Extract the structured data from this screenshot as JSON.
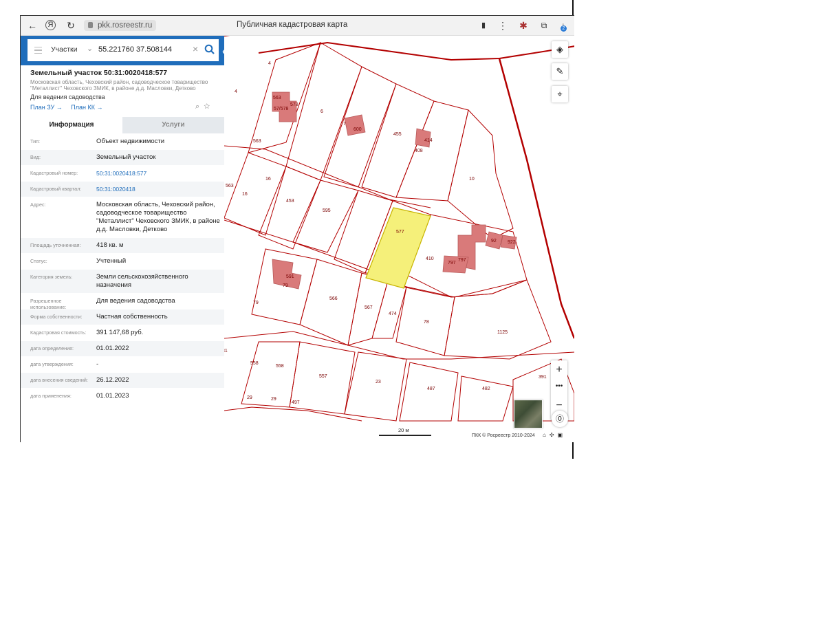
{
  "browser": {
    "url": "pkk.rosreestr.ru",
    "title": "Публичная кадастровая карта",
    "download_count": "2",
    "icons": [
      "back-arrow-icon",
      "yandex-icon",
      "reload-icon",
      "lock-icon",
      "bookmark-icon",
      "menu-dots-icon",
      "extension-icon",
      "translate-icon",
      "download-icon"
    ]
  },
  "search": {
    "type_label": "Участки",
    "value": "55.221760 37.508144"
  },
  "object": {
    "title": "Земельный участок 50:31:0020418:577",
    "address_short": "Московская область, Чеховский район, садоводческое товарищество \"Металлист\" Чеховского ЗМИК, в районе д.д. Масловки, Детково",
    "use": "Для ведения садоводства",
    "plan_zu": "План ЗУ →",
    "plan_kk": "План КК →"
  },
  "tabs": {
    "info": "Информация",
    "services": "Услуги"
  },
  "rows": [
    {
      "label": "Тип:",
      "value": "Объект недвижимости"
    },
    {
      "label": "Вид:",
      "value": "Земельный участок"
    },
    {
      "label": "Кадастровый номер:",
      "value": "50:31:0020418:577",
      "link": true
    },
    {
      "label": "Кадастровый квартал:",
      "value": "50:31:0020418",
      "link": true
    },
    {
      "label": "Адрес:",
      "value": "Московская область, Чеховский район, садоводческое товарищество \"Металлист\" Чеховского ЗМИК, в районе д.д. Масловки, Детково"
    },
    {
      "label": "Площадь уточненная:",
      "value": "418 кв. м"
    },
    {
      "label": "Статус:",
      "value": "Учтенный"
    },
    {
      "label": "Категория земель:",
      "value": "Земли сельскохозяйственного назначения"
    },
    {
      "label": "Разрешенное использование:",
      "value": "Для ведения садоводства"
    },
    {
      "label": "Форма собственности:",
      "value": "Частная собственность"
    },
    {
      "label": "Кадастровая стоимость:",
      "value": "391 147,68 руб."
    },
    {
      "label": "дата определения:",
      "value": "01.01.2022"
    },
    {
      "label": "дата утверждения:",
      "value": "-"
    },
    {
      "label": "дата внесения сведений:",
      "value": "26.12.2022"
    },
    {
      "label": "дата применения:",
      "value": "01.01.2023"
    }
  ],
  "map": {
    "parcel_color": "#b30000",
    "building_color": "#d97a7a",
    "selected_color": "#f5f07a",
    "scale_label": "20 м",
    "copyright": "ПКК © Росреестр 2010-2024",
    "labels": [
      "4",
      "4",
      "563",
      "578",
      "57/578",
      "6",
      "7",
      "600",
      "455",
      "408",
      "414",
      "10",
      "16",
      "16",
      "453",
      "595",
      "577",
      "922",
      "92",
      "797",
      "797",
      "410",
      "591",
      "79",
      "79",
      "566",
      "567",
      "474",
      "78",
      "1125",
      "81",
      "558",
      "558",
      "557",
      "23",
      "487",
      "482",
      "391",
      "29",
      "29",
      "497",
      "563",
      "563"
    ]
  }
}
